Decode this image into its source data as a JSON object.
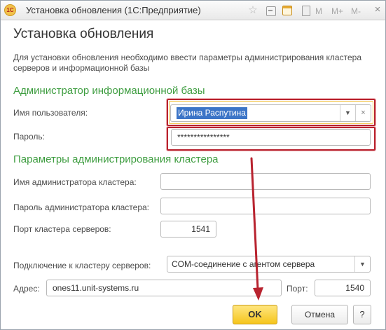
{
  "window": {
    "app_logo": "1С",
    "title": "Установка обновления  (1С:Предприятие)",
    "toolbar": {
      "m_label": "M",
      "m_plus_label": "M+",
      "m_minus_label": "M-",
      "close_glyph": "×",
      "icons": [
        "star-icon",
        "link-icon",
        "calendar-icon",
        "calculator-icon"
      ]
    }
  },
  "dialog": {
    "title": "Установка обновления",
    "description": "Для установки обновления необходимо ввести параметры администрирования кластера серверов и информационной базы"
  },
  "infobase_admin": {
    "section_title": "Администратор информационной базы",
    "username_label": "Имя пользователя:",
    "username_value": "Ирина Распутина",
    "password_label": "Пароль:",
    "password_value": "****************"
  },
  "cluster_admin": {
    "section_title": "Параметры администрирования кластера",
    "admin_name_label": "Имя администратора кластера:",
    "admin_name_value": "",
    "admin_password_label": "Пароль администратора кластера:",
    "admin_password_value": "",
    "cluster_port_label": "Порт кластера серверов:",
    "cluster_port_value": "1541",
    "connection_label": "Подключение к кластеру серверов:",
    "connection_value": "COM-соединение с агентом сервера",
    "address_label": "Адрес:",
    "address_value": "ones11.unit-systems.ru",
    "port_label": "Порт:",
    "port_value": "1540"
  },
  "buttons": {
    "ok": "OK",
    "cancel": "Отмена",
    "help": "?"
  },
  "colors": {
    "section_green": "#3e9d40",
    "annotation_red": "#b8232f",
    "ok_yellow": "#f5c51c",
    "selection_blue": "#3c75c7"
  }
}
